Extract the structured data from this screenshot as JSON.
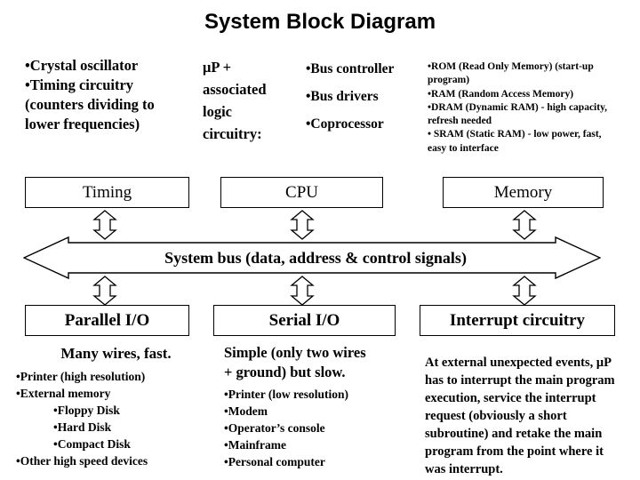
{
  "title": "System Block Diagram",
  "top_columns": {
    "timing": [
      "•Crystal oscillator",
      "•Timing circuitry",
      "(counters dividing to",
      "lower frequencies)"
    ],
    "cpu": [
      "μP +",
      "associated",
      "logic",
      "circuitry:"
    ],
    "cpu_parts": [
      "•Bus controller",
      "•Bus drivers",
      "•Coprocessor"
    ],
    "memory": [
      "•ROM (Read Only Memory)  (start-up",
      "program)",
      "•RAM (Random Access Memory)",
      "•DRAM (Dynamic RAM) - high capacity,",
      "refresh needed",
      "• SRAM (Static RAM) - low power, fast,",
      "easy to interface"
    ]
  },
  "boxes": {
    "timing": "Timing",
    "cpu": "CPU",
    "memory": "Memory",
    "parallel_io": "Parallel I/O",
    "serial_io": "Serial I/O",
    "interrupt": "Interrupt circuitry"
  },
  "bus": {
    "label": "System bus (data, address & control signals)"
  },
  "bottom_columns": {
    "parallel": {
      "heading": "Many wires, fast.",
      "items": [
        {
          "text": "•Printer (high resolution)",
          "level": 0
        },
        {
          "text": "•External memory",
          "level": 0
        },
        {
          "text": "•Floppy Disk",
          "level": 1
        },
        {
          "text": "•Hard Disk",
          "level": 1
        },
        {
          "text": "•Compact Disk",
          "level": 1
        },
        {
          "text": "•Other high speed devices",
          "level": 0
        }
      ]
    },
    "serial": {
      "heading_line1": "Simple (only two wires",
      "heading_line2": "+ ground) but slow.",
      "items": [
        {
          "text": "•Printer (low resolution)",
          "level": 0
        },
        {
          "text": "•Modem",
          "level": 0
        },
        {
          "text": "•Operator’s console",
          "level": 0
        },
        {
          "text": "•Mainframe",
          "level": 0
        },
        {
          "text": "•Personal computer",
          "level": 0
        }
      ]
    },
    "interrupt": {
      "lines": [
        "At external unexpected events, μP",
        "has to interrupt the main program",
        "execution, service the interrupt",
        "request (obviously a short",
        "subroutine) and retake the main",
        "program from the point where it",
        "was interrupt."
      ]
    }
  },
  "colors": {
    "background": "#ffffff",
    "ink": "#000000",
    "stroke": "#000000"
  }
}
